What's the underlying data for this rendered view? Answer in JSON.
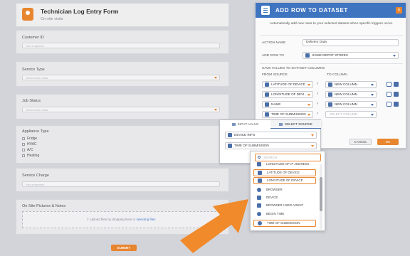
{
  "form": {
    "title": "Technician Log Entry Form",
    "subtitle": "On-site visits",
    "brand_color": "#e8852f",
    "fields": [
      {
        "label": "Customer ID",
        "placeholder": "Your response"
      },
      {
        "label": "Service Type",
        "placeholder": "Select from below"
      },
      {
        "label": "Job Status",
        "placeholder": "Select from below"
      }
    ],
    "appliance": {
      "label": "Appliance Type",
      "options": [
        "Fridge",
        "HVAC",
        "A/C",
        "Heating"
      ]
    },
    "charge": {
      "label": "Service Charge",
      "placeholder": "Your response"
    },
    "pictures": {
      "label": "On-Site Pictures & Notes",
      "upload_text": "Upload files by dropping here or",
      "upload_link": "selecting files"
    },
    "submit_label": "SUBMIT"
  },
  "modal": {
    "title": "ADD ROW TO DATASET",
    "header_color": "#3f74c0",
    "close_label": "×",
    "description": "Automatically add new rows to your selected dataset when specific triggers occur.",
    "action_name_label": "ACTION NAME",
    "action_name_value": "Delivery Data",
    "add_row_label": "ADD ROW TO",
    "add_row_value": "HOME DEPOT STORES",
    "save_values_label": "SAVE VALUES TO DATASET COLUMNS",
    "from_source_label": "FROM SOURCE",
    "to_column_label": "TO COLUMN",
    "mappings": [
      {
        "source": "LATITUDE OF DEVICE",
        "column": "NEW COLUMN"
      },
      {
        "source": "LONGITUDE OF DEVI...",
        "column": "NEW COLUMN"
      },
      {
        "source": "NAME",
        "column": "NEW COLUMN"
      },
      {
        "source": "TIME OF SUBMISSION",
        "column": "SELECT COLUMN"
      }
    ],
    "cancel_label": "CANCEL",
    "ok_label": "OK"
  },
  "source_popover": {
    "tab_input": "INPUT VALUE",
    "tab_source": "SELECT SOURCE",
    "source_type": "DEVICE INFO",
    "source_field": "TIME OF SUBMISSION"
  },
  "dropdown": {
    "search_placeholder": "SEARCH",
    "options": [
      {
        "label": "LONGITUDE OF IP ADDRESS",
        "icon": "location-icon",
        "highlighted": false
      },
      {
        "label": "LATITUDE OF DEVICE",
        "icon": "location-icon",
        "highlighted": true
      },
      {
        "label": "LONGITUDE OF DEVICE",
        "icon": "location-icon",
        "highlighted": true
      },
      {
        "label": "BROWSER",
        "icon": "globe-icon",
        "highlighted": false
      },
      {
        "label": "DEVICE",
        "icon": "device-icon",
        "highlighted": false
      },
      {
        "label": "BROWSER USER AGENT",
        "icon": "user-agent-icon",
        "highlighted": false
      },
      {
        "label": "BEGIN TIME",
        "icon": "clock-icon",
        "highlighted": false
      },
      {
        "label": "TIME OF SUBMISSION",
        "icon": "clock-icon",
        "highlighted": true
      }
    ]
  },
  "accent_arrow_color": "#f08a2a"
}
